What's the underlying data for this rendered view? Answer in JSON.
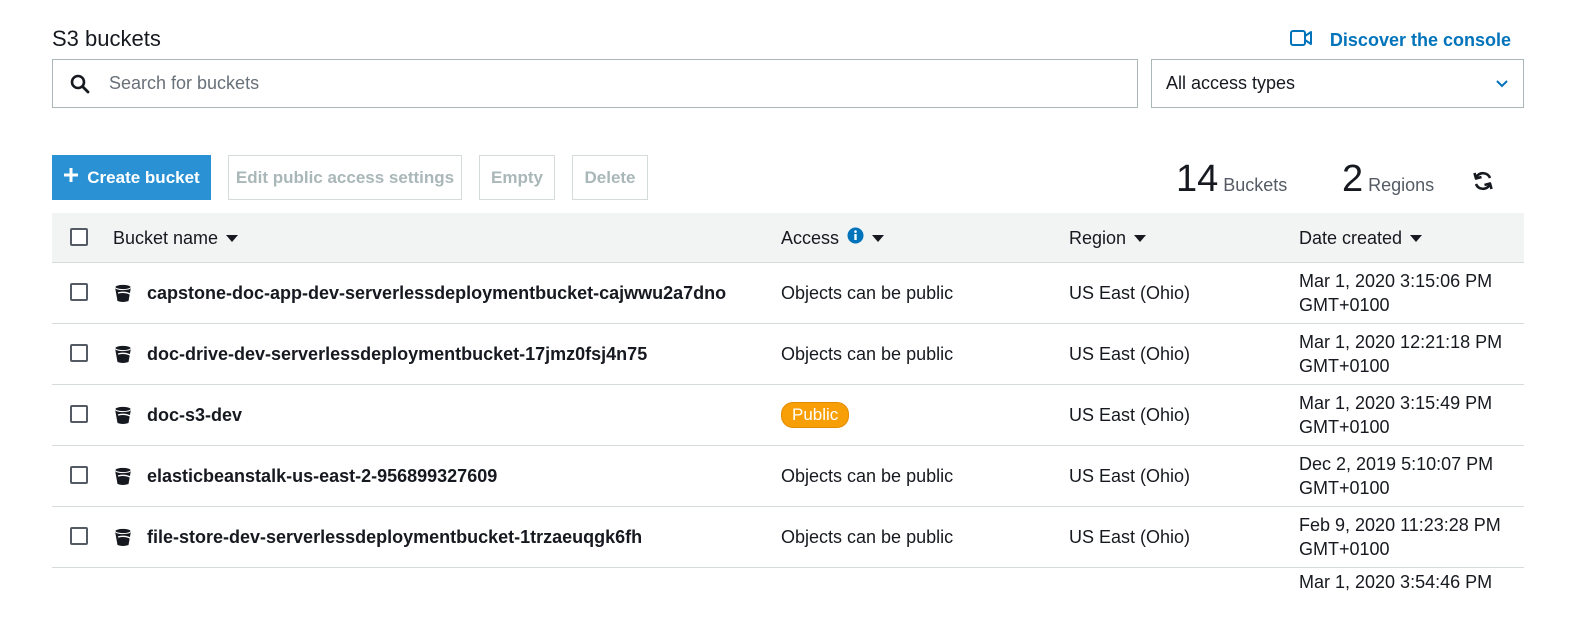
{
  "page": {
    "title": "S3 buckets",
    "discover_label": "Discover the console"
  },
  "search": {
    "placeholder": "Search for buckets",
    "value": ""
  },
  "filter": {
    "selected": "All access types"
  },
  "toolbar": {
    "create_label": "Create bucket",
    "edit_label": "Edit public access settings",
    "empty_label": "Empty",
    "delete_label": "Delete"
  },
  "stats": {
    "buckets_count": "14",
    "buckets_label": "Buckets",
    "regions_count": "2",
    "regions_label": "Regions"
  },
  "table": {
    "columns": {
      "name": "Bucket name",
      "access": "Access",
      "region": "Region",
      "date": "Date created"
    },
    "rows": [
      {
        "name": "capstone-doc-app-dev-serverlessdeploymentbucket-cajwwu2a7dno",
        "access": "Objects can be public",
        "access_public": false,
        "region": "US East (Ohio)",
        "date": "Mar 1, 2020 3:15:06 PM",
        "tz": "GMT+0100"
      },
      {
        "name": "doc-drive-dev-serverlessdeploymentbucket-17jmz0fsj4n75",
        "access": "Objects can be public",
        "access_public": false,
        "region": "US East (Ohio)",
        "date": "Mar 1, 2020 12:21:18 PM",
        "tz": "GMT+0100"
      },
      {
        "name": "doc-s3-dev",
        "access": "Public",
        "access_public": true,
        "region": "US East (Ohio)",
        "date": "Mar 1, 2020 3:15:49 PM",
        "tz": "GMT+0100"
      },
      {
        "name": "elasticbeanstalk-us-east-2-956899327609",
        "access": "Objects can be public",
        "access_public": false,
        "region": "US East (Ohio)",
        "date": "Dec 2, 2019 5:10:07 PM",
        "tz": "GMT+0100"
      },
      {
        "name": "file-store-dev-serverlessdeploymentbucket-1trzaeuqgk6fh",
        "access": "Objects can be public",
        "access_public": false,
        "region": "US East (Ohio)",
        "date": "Feb 9, 2020 11:23:28 PM",
        "tz": "GMT+0100"
      },
      {
        "name": "",
        "access": "",
        "access_public": false,
        "region": "",
        "date": "Mar 1, 2020 3:54:46 PM",
        "tz": ""
      }
    ]
  },
  "colors": {
    "accent": "#0073bb",
    "primary_button": "#2a92d4",
    "public_badge": "#f89f07",
    "header_bg": "#f2f3f3"
  },
  "icons": [
    "video-icon",
    "search-icon",
    "chevron-down-icon",
    "plus-icon",
    "refresh-icon",
    "info-icon",
    "bucket-icon",
    "sort-caret-icon"
  ]
}
